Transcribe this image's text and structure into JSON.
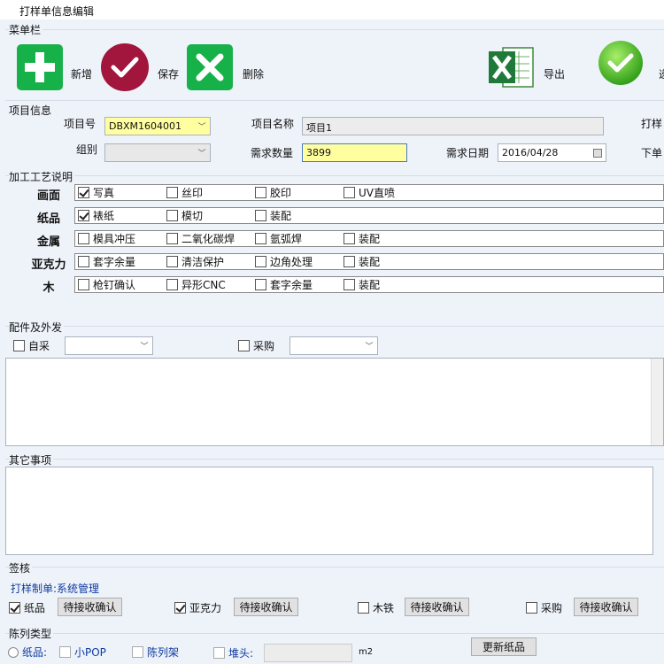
{
  "window": {
    "title": "打样单信息编辑"
  },
  "menu": {
    "label": "菜单栏",
    "add": "新增",
    "save": "保存",
    "delete": "删除",
    "export": "导出",
    "confirm": "递"
  },
  "project": {
    "label": "项目信息",
    "id_label": "项目号",
    "id_value": "DBXM1604001",
    "name_label": "项目名称",
    "name_value": "项目1",
    "proof_label": "打样",
    "group_label": "组别",
    "group_value": "",
    "qty_label": "需求数量",
    "qty_value": "3899",
    "date_label": "需求日期",
    "date_value": "2016/04/28",
    "order_label": "下单"
  },
  "process": {
    "label": "加工工艺说明",
    "rows": [
      {
        "name": "画面",
        "items": [
          {
            "t": "写真",
            "c": true
          },
          {
            "t": "丝印",
            "c": false
          },
          {
            "t": "胶印",
            "c": false
          },
          {
            "t": "UV直喷",
            "c": false
          }
        ]
      },
      {
        "name": "纸品",
        "items": [
          {
            "t": "裱纸",
            "c": true
          },
          {
            "t": "模切",
            "c": false
          },
          {
            "t": "装配",
            "c": false
          }
        ]
      },
      {
        "name": "金属",
        "items": [
          {
            "t": "模具冲压",
            "c": false
          },
          {
            "t": "二氧化碳焊",
            "c": false
          },
          {
            "t": "氩弧焊",
            "c": false
          },
          {
            "t": "装配",
            "c": false
          }
        ]
      },
      {
        "name": "亚克力",
        "items": [
          {
            "t": "套字余量",
            "c": false
          },
          {
            "t": "清洁保护",
            "c": false
          },
          {
            "t": "边角处理",
            "c": false
          },
          {
            "t": "装配",
            "c": false
          }
        ]
      },
      {
        "name": "木",
        "items": [
          {
            "t": "枪钉确认",
            "c": false
          },
          {
            "t": "异形CNC",
            "c": false
          },
          {
            "t": "套字余量",
            "c": false
          },
          {
            "t": "装配",
            "c": false
          }
        ]
      }
    ]
  },
  "parts": {
    "label": "配件及外发",
    "self_label": "自采",
    "self_value": "",
    "buy_label": "采购",
    "buy_value": ""
  },
  "other": {
    "label": "其它事项"
  },
  "sign": {
    "label": "签核",
    "maker_label": "打样制单:",
    "maker_value": "系统管理",
    "items": [
      {
        "t": "纸品",
        "c": true,
        "btn": "待接收确认"
      },
      {
        "t": "亚克力",
        "c": true,
        "btn": "待接收确认"
      },
      {
        "t": "木铁",
        "c": false,
        "btn": "待接收确认"
      },
      {
        "t": "采购",
        "c": false,
        "btn": "待接收确认"
      }
    ]
  },
  "display": {
    "label": "陈列类型",
    "paper_label": "纸品:",
    "small_pop": "小POP",
    "rack": "陈列架",
    "head_label": "堆头:",
    "head_value": "",
    "unit": "m2",
    "update_btn": "更新纸品"
  }
}
